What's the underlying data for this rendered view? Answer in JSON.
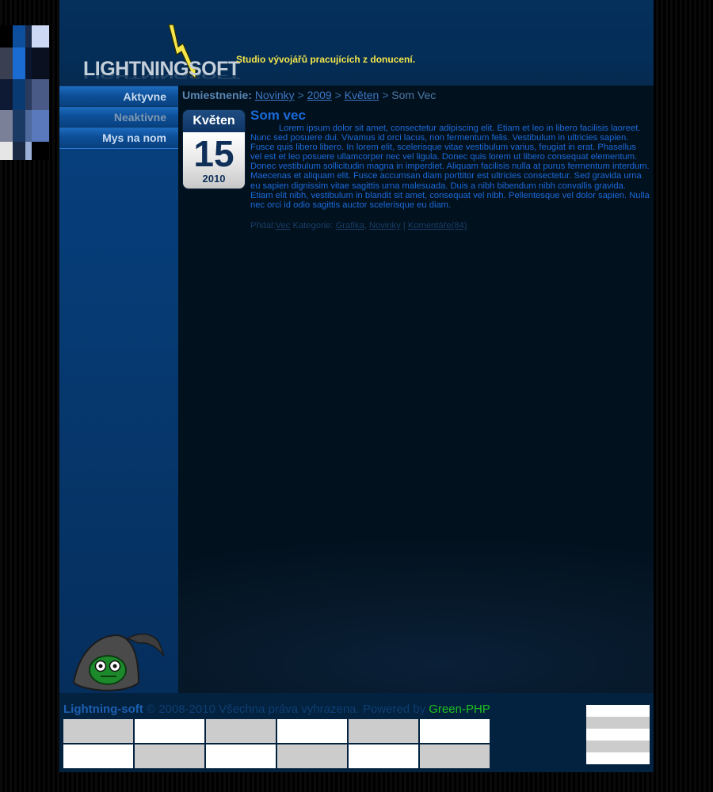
{
  "header": {
    "logo_text": "LIGHTNINGSOFT",
    "tagline": "Studio vývojářů pracujících z donucení."
  },
  "sidebar": {
    "items": [
      {
        "label": "Aktyvne",
        "color": "#c9dcf2"
      },
      {
        "label": "Neaktivne",
        "color": "#7f98b3"
      },
      {
        "label": "Mys na nom",
        "color": "#c9dcf2"
      }
    ]
  },
  "breadcrumb": {
    "label": "Umiestnenie:",
    "links": [
      "Novinky",
      "2009",
      "Květen"
    ],
    "separator": ">",
    "current": "Som Vec"
  },
  "calendar": {
    "month": "Květen",
    "day": "15",
    "year": "2010"
  },
  "post": {
    "title": "Som vec",
    "body": "Lorem ipsum dolor sit amet, consectetur adipiscing elit. Etiam et leo in libero facilisis laoreet. Nunc sed posuere dui. Vivamus id orci lacus, non fermentum felis. Vestibulum in ultricies sapien. Fusce quis libero libero. In lorem elit, scelerisque vitae vestibulum varius, feugiat in erat. Phasellus vel est et leo posuere ullamcorper nec vel ligula. Donec quis lorem ut libero consequat elementum. Donec vestibulum sollicitudin magna in imperdiet. Aliquam facilisis nulla at purus fermentum interdum. Maecenas et aliquam elit. Fusce accumsan diam porttitor est ultricies consectetur. Sed gravida urna eu sapien dignissim vitae sagittis urna malesuada. Duis a nibh bibendum nibh convallis gravida. Etiam elit nibh, vestibulum in blandit sit amet, consequat vel nibh. Pellentesque vel dolor sapien. Nulla nec orci id odio sagittis auctor scelerisque eu diam.",
    "meta": {
      "added_by_label": "Přidal:",
      "author": "Vec",
      "category_label": "Kategorie:",
      "categories": [
        "Grafika",
        "Novinky"
      ],
      "pipe": "|",
      "comments": "Komentáře(84)"
    }
  },
  "footer": {
    "brand": "Lightning-soft",
    "copyright": " © 2008-2010 Všechna práva vyhrazena. Powered by ",
    "powered_green": "Green",
    "powered_rest": "-PHP"
  },
  "colors": {
    "accent_blue": "#1a6ad8",
    "tagline_yellow": "#f4e64a",
    "green_php": "#1fc21f"
  }
}
